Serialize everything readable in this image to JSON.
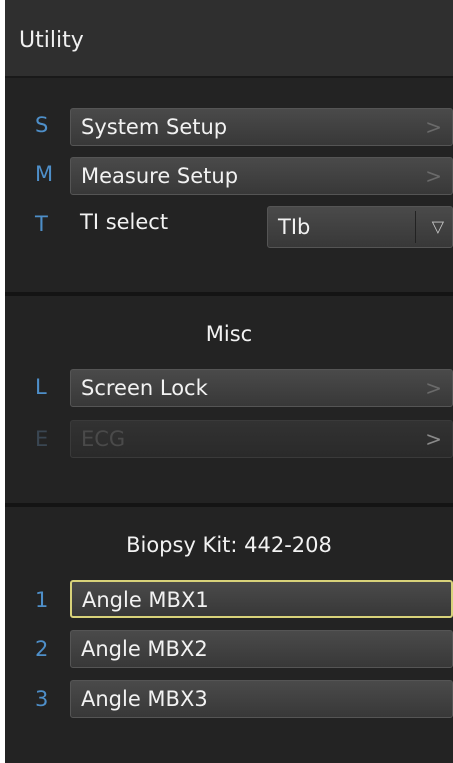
{
  "title": "Utility",
  "setup": {
    "items": [
      {
        "key": "S",
        "label": "System Setup",
        "chevron": ">"
      },
      {
        "key": "M",
        "label": "Measure Setup",
        "chevron": ">"
      }
    ],
    "ti": {
      "key": "T",
      "label": "TI select",
      "value": "TIb",
      "arrow": "▽"
    }
  },
  "misc": {
    "title": "Misc",
    "items": [
      {
        "key": "L",
        "label": "Screen Lock",
        "chevron": ">"
      },
      {
        "key": "E",
        "label": "ECG",
        "chevron": ">"
      }
    ]
  },
  "biopsy": {
    "title": "Biopsy Kit: 442-208",
    "items": [
      {
        "key": "1",
        "label": "Angle MBX1"
      },
      {
        "key": "2",
        "label": "Angle MBX2"
      },
      {
        "key": "3",
        "label": "Angle MBX3"
      }
    ]
  },
  "colors": {
    "accent_key": "#4e8fc9",
    "selected_border": "#d8d27a",
    "panel_bg": "#232323"
  }
}
